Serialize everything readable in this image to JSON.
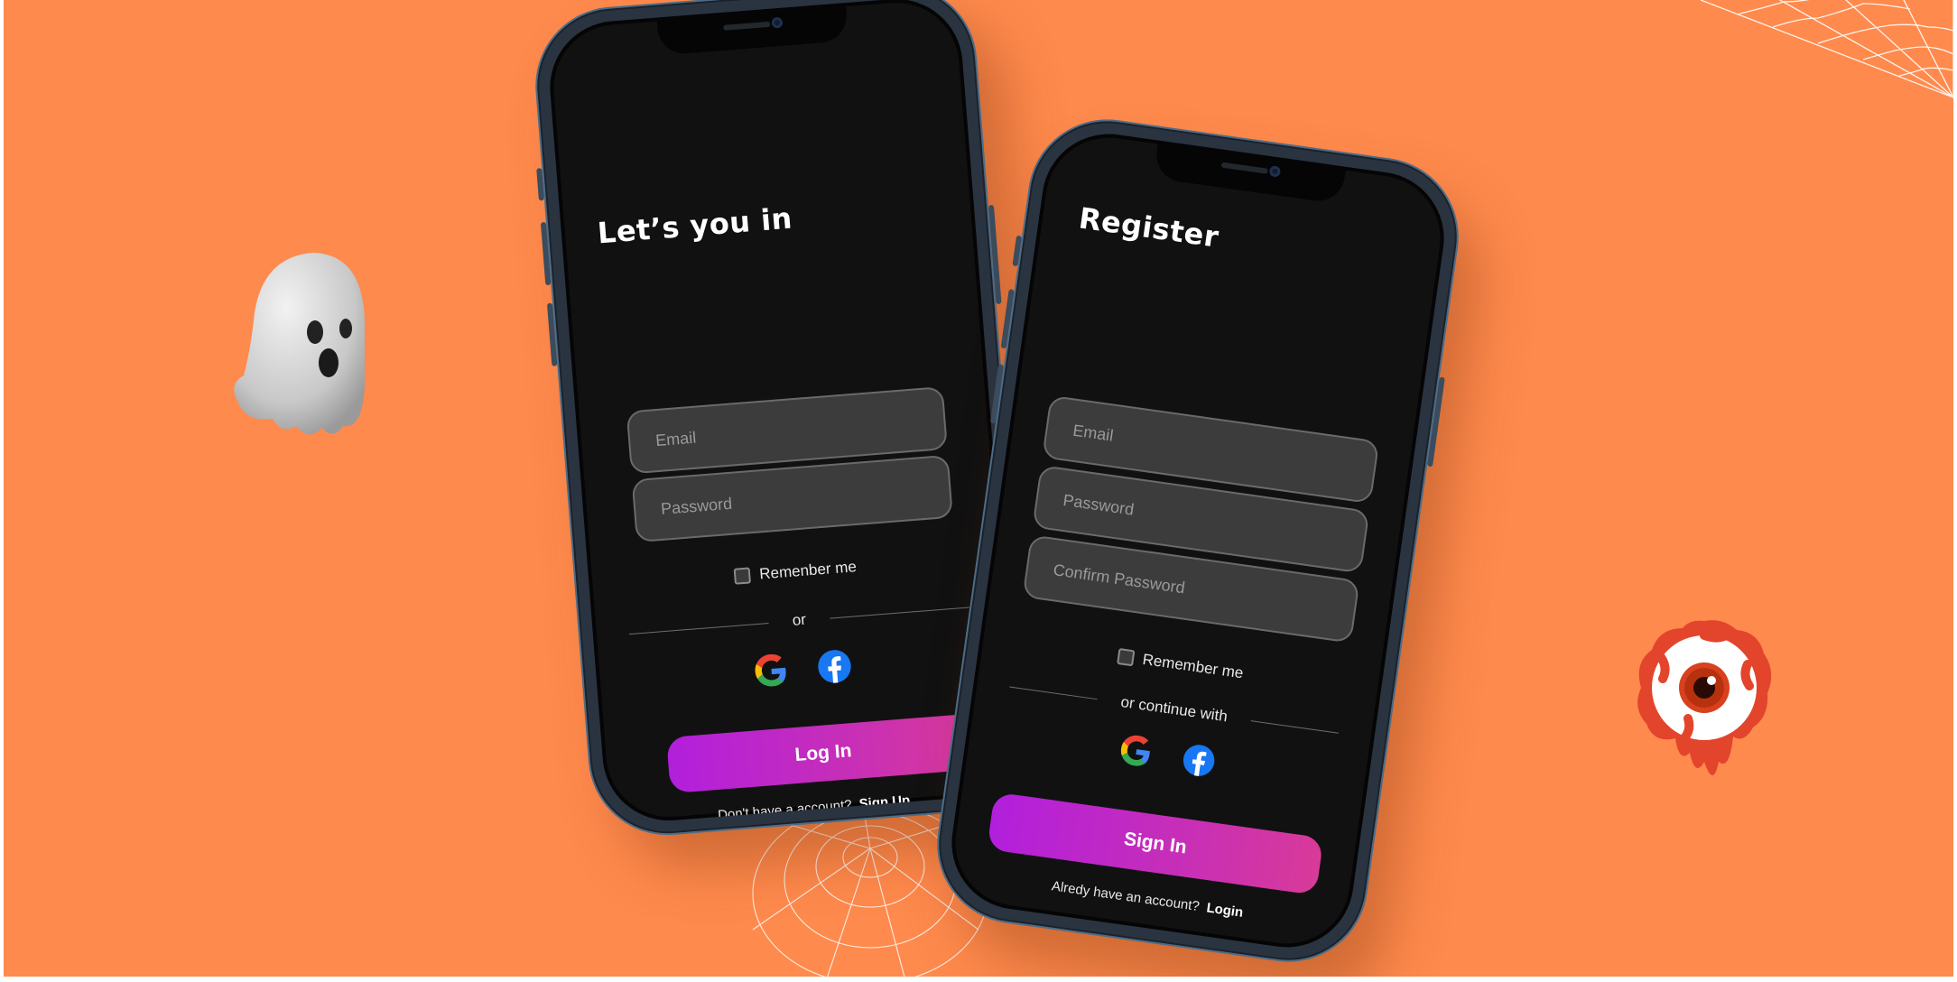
{
  "colors": {
    "background": "#FF8A4D",
    "screen": "#111111",
    "field": "#3C3C3C",
    "button_gradient_start": "#B21FDC",
    "button_gradient_end": "#D83A98",
    "phone_frame": "#2A3440"
  },
  "login_screen": {
    "title": "Let’s you in",
    "email_placeholder": "Email",
    "password_placeholder": "Password",
    "remember_label": "Remenber me",
    "divider_text": "or",
    "social_icons": [
      "google-icon",
      "facebook-icon"
    ],
    "button_label": "Log In",
    "footer_text": "Don't have a account?",
    "footer_link": "Sign Up"
  },
  "register_screen": {
    "title": "Register",
    "email_placeholder": "Email",
    "password_placeholder": "Password",
    "confirm_placeholder": "Confirm Password",
    "remember_label": "Remember me",
    "divider_text": "or continue with",
    "social_icons": [
      "google-icon",
      "facebook-icon"
    ],
    "button_label": "Sign In",
    "footer_text": "Alredy have an account?",
    "footer_link": "Login"
  },
  "decorations": [
    "ghost-icon",
    "eyeball-icon",
    "spider-web-icon"
  ]
}
